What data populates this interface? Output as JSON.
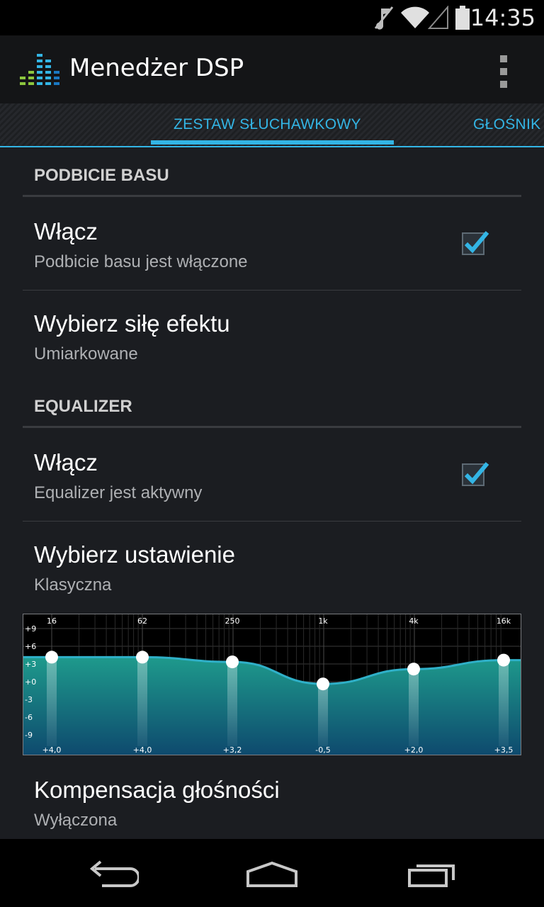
{
  "status_bar": {
    "time": "14:35",
    "icons": [
      "mute-icon",
      "wifi-icon",
      "signal-icon",
      "battery-icon"
    ]
  },
  "app_bar": {
    "title": "Menedżer DSP",
    "logo_icon": "equalizer-logo-icon",
    "menu_icon": "overflow-menu-icon"
  },
  "tabs": [
    {
      "label": "ZESTAW SŁUCHAWKOWY",
      "selected": true
    },
    {
      "label": "GŁOŚNIK",
      "selected": false
    }
  ],
  "bass_section": {
    "header": "PODBICIE BASU",
    "enable_title": "Włącz",
    "enable_summary": "Podbicie basu jest włączone",
    "enable_checked": true,
    "strength_title": "Wybierz siłę efektu",
    "strength_summary": "Umiarkowane"
  },
  "eq_section": {
    "header": "EQUALIZER",
    "enable_title": "Włącz",
    "enable_summary": "Equalizer jest aktywny",
    "enable_checked": true,
    "preset_title": "Wybierz ustawienie",
    "preset_summary": "Klasyczna"
  },
  "equalizer": {
    "db_labels": [
      "+9",
      "+6",
      "+3",
      "+0",
      "-3",
      "-6",
      "-9"
    ],
    "bands": [
      {
        "freq": "16",
        "gain": 4.0,
        "gain_label": "+4,0"
      },
      {
        "freq": "62",
        "gain": 4.0,
        "gain_label": "+4,0"
      },
      {
        "freq": "250",
        "gain": 3.2,
        "gain_label": "+3,2"
      },
      {
        "freq": "1k",
        "gain": -0.5,
        "gain_label": "-0,5"
      },
      {
        "freq": "4k",
        "gain": 2.0,
        "gain_label": "+2,0"
      },
      {
        "freq": "16k",
        "gain": 3.5,
        "gain_label": "+3,5"
      }
    ],
    "colors": {
      "fill_top": "#1e9a8c",
      "fill_bottom": "#0e4a6e",
      "line": "#2fb0c8"
    }
  },
  "loudness": {
    "title": "Kompensacja głośności",
    "summary": "Wyłączona"
  },
  "nav_bar": {
    "icons": [
      "back-icon",
      "home-icon",
      "recent-apps-icon"
    ]
  },
  "accent_color": "#33b5e5"
}
